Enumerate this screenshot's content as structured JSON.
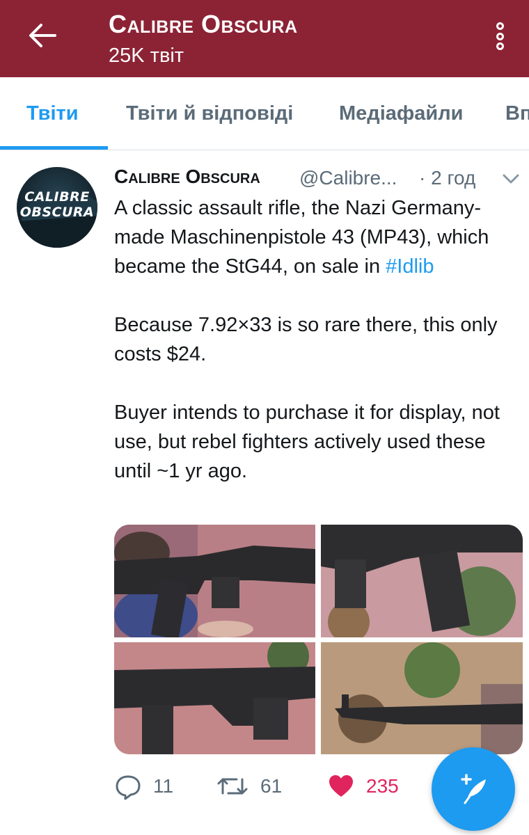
{
  "header": {
    "title": "Calibre Obscura",
    "subtitle": "25K твіт"
  },
  "tabs": [
    {
      "label": "Твіти",
      "active": true
    },
    {
      "label": "Твіти й відповіді",
      "active": false
    },
    {
      "label": "Медіафайли",
      "active": false
    },
    {
      "label": "Вподобання",
      "active": false
    }
  ],
  "avatar": {
    "line1": "CALIBRE",
    "line2": "OBSCURA"
  },
  "tweet": {
    "author_name": "Calibre Obscura",
    "author_handle": "@Calibre...",
    "time": "· 2 год",
    "paragraph1": "A classic assault rifle, the Nazi Germany-made Maschinenpistole 43 (MP43), which became the StG44, on sale in ",
    "hashtag": "#Idlib",
    "paragraph2": "Because 7.92×33 is so rare there, this only costs $24.",
    "paragraph3": "Buyer intends to purchase it for display, not use, but rebel fighters actively used these until ~1 yr ago.",
    "replies": "11",
    "retweets": "61",
    "likes": "235"
  },
  "colors": {
    "header_bg": "#8c2335",
    "accent": "#1d9bf0",
    "like": "#e0245e",
    "muted": "#5b6b78"
  },
  "icons": [
    "arrow-left-icon",
    "more-vertical-icon",
    "chevron-down-icon",
    "reply-icon",
    "retweet-icon",
    "heart-icon",
    "compose-feather-icon"
  ]
}
